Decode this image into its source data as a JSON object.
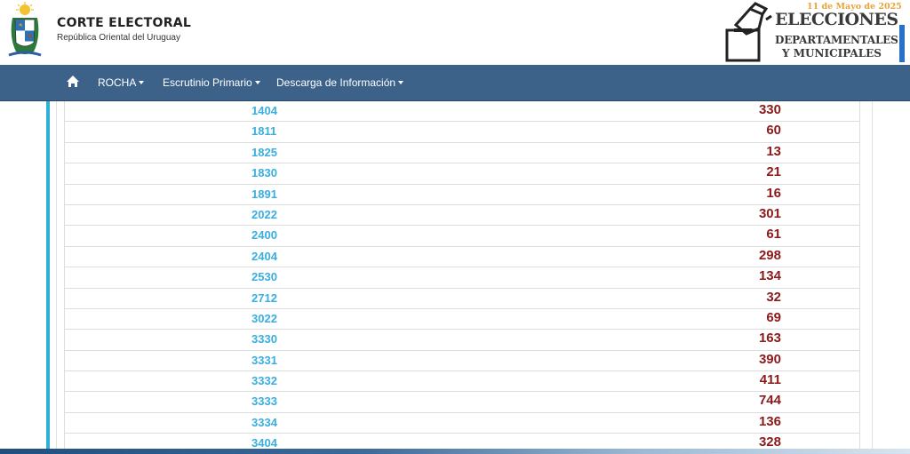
{
  "header": {
    "org_title": "CORTE ELECTORAL",
    "org_subtitle": "República Oriental del Uruguay",
    "banner": {
      "date": "11 de Mayo de 2025",
      "line1": "ELECCIONES",
      "line2": "DEPARTAMENTALES",
      "line3": "Y MUNICIPALES"
    }
  },
  "nav": {
    "home_icon": "home-icon",
    "items": [
      {
        "label": "ROCHA"
      },
      {
        "label": "Escrutinio Primario"
      },
      {
        "label": "Descarga de Información"
      }
    ]
  },
  "colors": {
    "navbar": "#3c6289",
    "link": "#39aee0",
    "value": "#8b1a1a",
    "accent": "#31b0d5"
  },
  "table": {
    "rows": [
      {
        "id": "1404",
        "value": "330"
      },
      {
        "id": "1811",
        "value": "60"
      },
      {
        "id": "1825",
        "value": "13"
      },
      {
        "id": "1830",
        "value": "21"
      },
      {
        "id": "1891",
        "value": "16"
      },
      {
        "id": "2022",
        "value": "301"
      },
      {
        "id": "2400",
        "value": "61"
      },
      {
        "id": "2404",
        "value": "298"
      },
      {
        "id": "2530",
        "value": "134"
      },
      {
        "id": "2712",
        "value": "32"
      },
      {
        "id": "3022",
        "value": "69"
      },
      {
        "id": "3330",
        "value": "163"
      },
      {
        "id": "3331",
        "value": "390"
      },
      {
        "id": "3332",
        "value": "411"
      },
      {
        "id": "3333",
        "value": "744"
      },
      {
        "id": "3334",
        "value": "136"
      },
      {
        "id": "3404",
        "value": "328"
      }
    ]
  }
}
